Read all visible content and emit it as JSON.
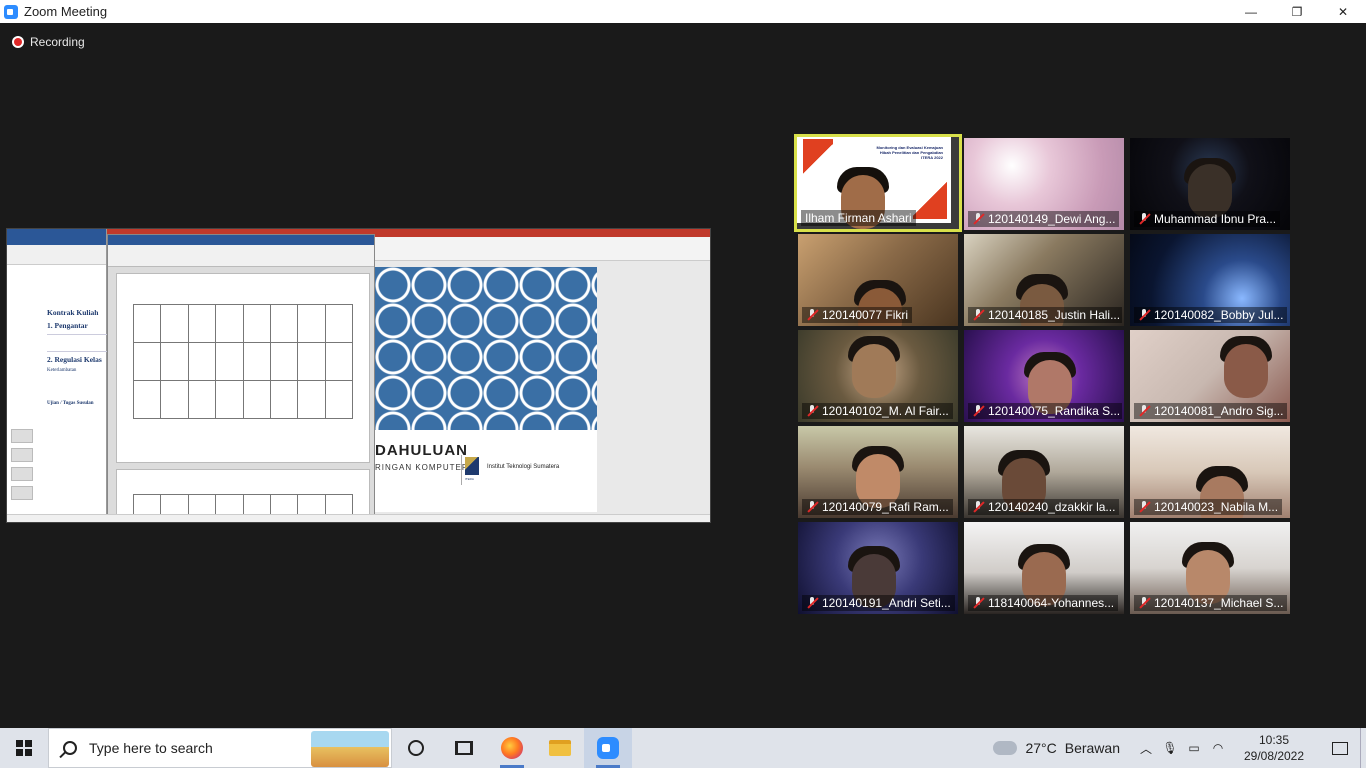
{
  "window": {
    "title": "Zoom Meeting",
    "controls": {
      "minimize": "—",
      "restore": "❐",
      "close": "✕"
    }
  },
  "meeting": {
    "recording_label": "Recording"
  },
  "shared_screen": {
    "doc_heading": "Kontrak Kuliah",
    "doc_section1": "1. Pengantar",
    "doc_section2": "2. Regulasi Kelas",
    "doc_sub1": "Keterlambatan",
    "doc_sub2": "Ujian / Tugas Susulan",
    "slide_title": "DAHULUAN",
    "slide_subtitle": "RINGAN KOMPUTER",
    "slide_logo_label": "ITERA",
    "slide_institution": "Institut Teknologi Sumatera"
  },
  "participants": [
    {
      "name": "Ilham Firman Ashari",
      "muted": false,
      "active_speaker": true,
      "banner": "Monitoring dan Evaluasi Kemajuan Hibah Penelitian dan Pengabdian ITERA 2022"
    },
    {
      "name": "120140149_Dewi Ang...",
      "muted": true
    },
    {
      "name": "Muhammad Ibnu Pra...",
      "muted": true
    },
    {
      "name": "120140077 Fikri",
      "muted": true
    },
    {
      "name": "120140185_Justin Hali...",
      "muted": true
    },
    {
      "name": "120140082_Bobby Jul...",
      "muted": true
    },
    {
      "name": "120140102_M. Al Fair...",
      "muted": true
    },
    {
      "name": "120140075_Randika S...",
      "muted": true
    },
    {
      "name": "120140081_Andro Sig...",
      "muted": true
    },
    {
      "name": "120140079_Rafi Ram...",
      "muted": true
    },
    {
      "name": "120140240_dzakkir la...",
      "muted": true
    },
    {
      "name": "120140023_Nabila M...",
      "muted": true
    },
    {
      "name": "120140191_Andri Seti...",
      "muted": true
    },
    {
      "name": "118140064-Yohannes...",
      "muted": true
    },
    {
      "name": "120140137_Michael S...",
      "muted": true
    }
  ],
  "taskbar": {
    "search_placeholder": "Type here to search",
    "weather_temp": "27°C",
    "weather_desc": "Berawan",
    "time": "10:35",
    "date": "29/08/2022"
  }
}
